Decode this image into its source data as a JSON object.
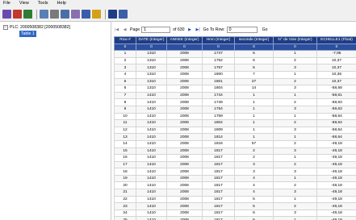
{
  "menu": [
    "File",
    "View",
    "Tools",
    "Help"
  ],
  "toolbar": {
    "icons": [
      "open-icon",
      "refresh-icon",
      "filter-icon",
      "export-icon",
      "copy-icon",
      "print-icon",
      "image-icon",
      "chart-icon",
      "grid-icon",
      "clipboard-icon",
      "table-icon"
    ],
    "colors": [
      "#6b4ab0",
      "#c0392b",
      "#2e7d32",
      "#5a7fb5",
      "#7a7a7a",
      "#4a6fa8",
      "#8a6fb0",
      "#3a5ea8",
      "#d4a017",
      "#1f3d84",
      "#3a5ea8"
    ]
  },
  "tree": {
    "root_label": "PLC: 2000508382 [2000508382]",
    "root_expander": "−",
    "child_label": "Table 1"
  },
  "navbar": {
    "first": "|◀",
    "prev": "◀",
    "page_label": "Page",
    "page_value": "1",
    "of_label": "of 630",
    "next": "▶",
    "last": "▶|",
    "goto_label": "Go To Row:",
    "goto_value": "0",
    "go_button": "Go"
  },
  "table": {
    "columns": [
      "Row #",
      "DATE (Integer)",
      "ANNEE (Integer)",
      "Hmn (Integer)",
      "seconde (Integer)",
      "N° de Voie (Integer)",
      "ECHELLE1 (Float)"
    ],
    "rows": [
      [
        "0",
        "0",
        "0",
        "0",
        "0",
        "0",
        "0"
      ],
      [
        "1",
        "1310",
        "2008",
        "1747",
        "5",
        "1",
        "-7,95"
      ],
      [
        "2",
        "1310",
        "2008",
        "1752",
        "5",
        "2",
        "10,37"
      ],
      [
        "3",
        "1310",
        "2008",
        "1757",
        "5",
        "3",
        "10,37"
      ],
      [
        "4",
        "1310",
        "2008",
        "1800",
        "7",
        "1",
        "10,36"
      ],
      [
        "5",
        "1310",
        "2008",
        "1801",
        "27",
        "2",
        "10,37"
      ],
      [
        "6",
        "1310",
        "2008",
        "1804",
        "14",
        "3",
        "-58,68"
      ],
      [
        "7",
        "1410",
        "2008",
        "1744",
        "1",
        "1",
        "-58,61"
      ],
      [
        "8",
        "1410",
        "2008",
        "1749",
        "1",
        "2",
        "-58,63"
      ],
      [
        "9",
        "1410",
        "2008",
        "1754",
        "1",
        "3",
        "-58,63"
      ],
      [
        "10",
        "1410",
        "2008",
        "1759",
        "1",
        "1",
        "-58,64"
      ],
      [
        "11",
        "1410",
        "2008",
        "1804",
        "1",
        "2",
        "-58,64"
      ],
      [
        "12",
        "1410",
        "2008",
        "1809",
        "1",
        "3",
        "-58,64"
      ],
      [
        "13",
        "1410",
        "2008",
        "1814",
        "1",
        "1",
        "-58,64"
      ],
      [
        "14",
        "1410",
        "2008",
        "1816",
        "57",
        "2",
        "-49,18"
      ],
      [
        "15",
        "1410",
        "2008",
        "1817",
        "2",
        "3",
        "-49,18"
      ],
      [
        "16",
        "1410",
        "2008",
        "1817",
        "2",
        "1",
        "-49,18"
      ],
      [
        "17",
        "1410",
        "2008",
        "1817",
        "3",
        "2",
        "-49,18"
      ],
      [
        "18",
        "1410",
        "2008",
        "1817",
        "3",
        "3",
        "-49,18"
      ],
      [
        "19",
        "1410",
        "2008",
        "1817",
        "4",
        "1",
        "-49,18"
      ],
      [
        "20",
        "1410",
        "2008",
        "1817",
        "4",
        "2",
        "-49,18"
      ],
      [
        "21",
        "1410",
        "2008",
        "1817",
        "4",
        "3",
        "-49,18"
      ],
      [
        "22",
        "1410",
        "2008",
        "1817",
        "5",
        "1",
        "-49,18"
      ],
      [
        "23",
        "1410",
        "2008",
        "1817",
        "5",
        "2",
        "-49,18"
      ],
      [
        "24",
        "1410",
        "2008",
        "1817",
        "6",
        "3",
        "-49,18"
      ],
      [
        "25",
        "1410",
        "2008",
        "1817",
        "6",
        "1",
        "-49,18"
      ]
    ]
  }
}
